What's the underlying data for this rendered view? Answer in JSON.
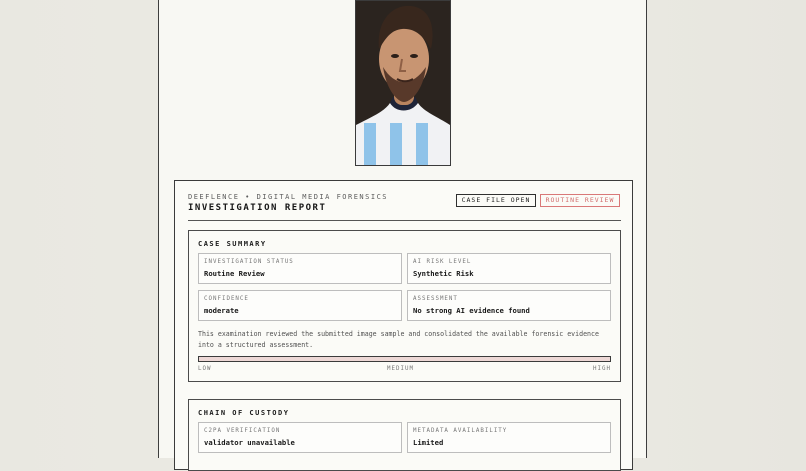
{
  "report": {
    "kicker": "DEEFLENCE • DIGITAL MEDIA FORENSICS",
    "title": "INVESTIGATION REPORT",
    "status_chip": "CASE FILE OPEN",
    "review_chip": "ROUTINE REVIEW"
  },
  "summary": {
    "title": "CASE SUMMARY",
    "fields": [
      {
        "label": "INVESTIGATION STATUS",
        "value": "Routine Review"
      },
      {
        "label": "AI RISK LEVEL",
        "value": "Synthetic Risk"
      },
      {
        "label": "CONFIDENCE",
        "value": "moderate"
      },
      {
        "label": "ASSESSMENT",
        "value": "No strong AI evidence found"
      }
    ],
    "narrative": "This examination reviewed the submitted image sample and consolidated the available forensic evidence into a structured assessment.",
    "risk_meter": {
      "value_fraction": 1.0,
      "low_label": "LOW",
      "medium_label": "MEDIUM",
      "high_label": "HIGH"
    }
  },
  "custody": {
    "title": "CHAIN OF CUSTODY",
    "fields": [
      {
        "label": "C2PA VERIFICATION",
        "value": "validator unavailable"
      },
      {
        "label": "METADATA AVAILABILITY",
        "value": "Limited"
      }
    ]
  },
  "colors": {
    "paper": "#f8f8f3",
    "accent_red": "#d97878",
    "meter_fill": "#edd8d6"
  }
}
